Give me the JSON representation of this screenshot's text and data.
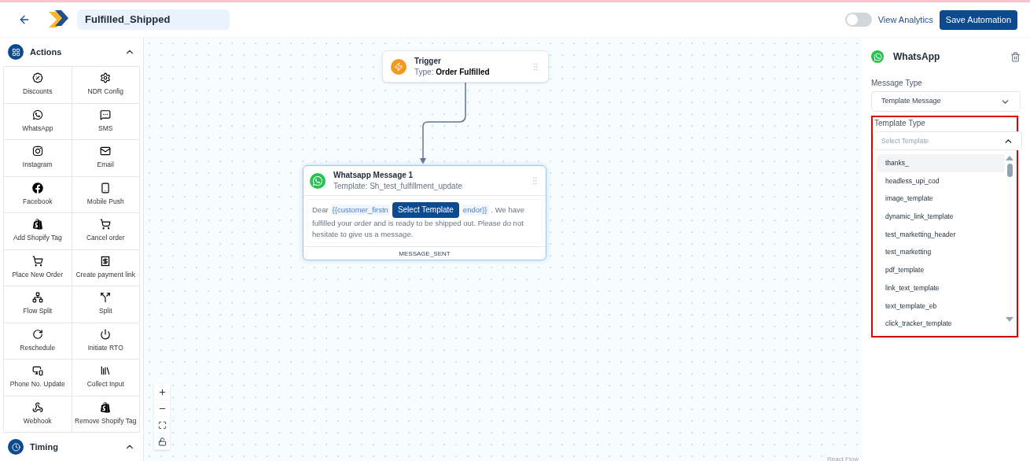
{
  "header": {
    "automation_name": "Fulfilled_Shipped",
    "analytics_toggle": {
      "label": "View Analytics",
      "on": false
    },
    "save_button": "Save Automation"
  },
  "sidebar": {
    "sections": [
      {
        "title": "Actions",
        "expanded": true,
        "items": [
          {
            "label": "Discounts"
          },
          {
            "label": "NDR Config"
          },
          {
            "label": "WhatsApp"
          },
          {
            "label": "SMS"
          },
          {
            "label": "Instagram"
          },
          {
            "label": "Email"
          },
          {
            "label": "Facebook"
          },
          {
            "label": "Mobile Push"
          },
          {
            "label": "Add Shopify Tag"
          },
          {
            "label": "Cancel order"
          },
          {
            "label": "Place New Order"
          },
          {
            "label": "Create payment link"
          },
          {
            "label": "Flow Split"
          },
          {
            "label": "Split"
          },
          {
            "label": "Reschedule"
          },
          {
            "label": "Initiate RTO"
          },
          {
            "label": "Phone No. Update"
          },
          {
            "label": "Collect Input"
          },
          {
            "label": "Webhook"
          },
          {
            "label": "Remove Shopify Tag"
          }
        ]
      },
      {
        "title": "Timing",
        "expanded": true
      }
    ]
  },
  "canvas": {
    "trigger_node": {
      "title": "Trigger",
      "type_label": "Type:",
      "type_value": "Order Fulfilled"
    },
    "message_node": {
      "title": "Whatsapp Message 1",
      "template": "Template: Sh_test_fulfillment_update",
      "body_start": "Dear",
      "variable_1": "{{customer_firstn",
      "select_button": "Select Template",
      "variable_2": "endor}}",
      "body_after": ". We have",
      "body_rest": "fulfilled your order and is ready to be shipped out. Please do not hesitate to give us a message.",
      "footer": "MESSAGE_SENT"
    },
    "controls": [
      {
        "kind": "zoom_in"
      },
      {
        "kind": "zoom_out"
      },
      {
        "kind": "fit_view"
      },
      {
        "kind": "lock"
      }
    ],
    "attribution": "React Flow"
  },
  "panel": {
    "title": "WhatsApp",
    "message_type": {
      "label": "Message Type",
      "value": "Template Message",
      "expanded": false
    },
    "template_type": {
      "label": "Template Type",
      "placeholder": "Select Template",
      "expanded": true,
      "highlighted": true,
      "options": [
        {
          "label": "thanks_",
          "selected": true
        },
        {
          "label": "headless_upi_cod",
          "selected": false
        },
        {
          "label": "image_template",
          "selected": false
        },
        {
          "label": "dynamic_link_template",
          "selected": false
        },
        {
          "label": "test_marketting_header",
          "selected": false
        },
        {
          "label": "test_marketting",
          "selected": false
        },
        {
          "label": "pdf_template",
          "selected": false
        },
        {
          "label": "link_text_template",
          "selected": false
        },
        {
          "label": "text_template_eb",
          "selected": false
        },
        {
          "label": "click_tracker_template",
          "selected": false
        }
      ]
    }
  }
}
